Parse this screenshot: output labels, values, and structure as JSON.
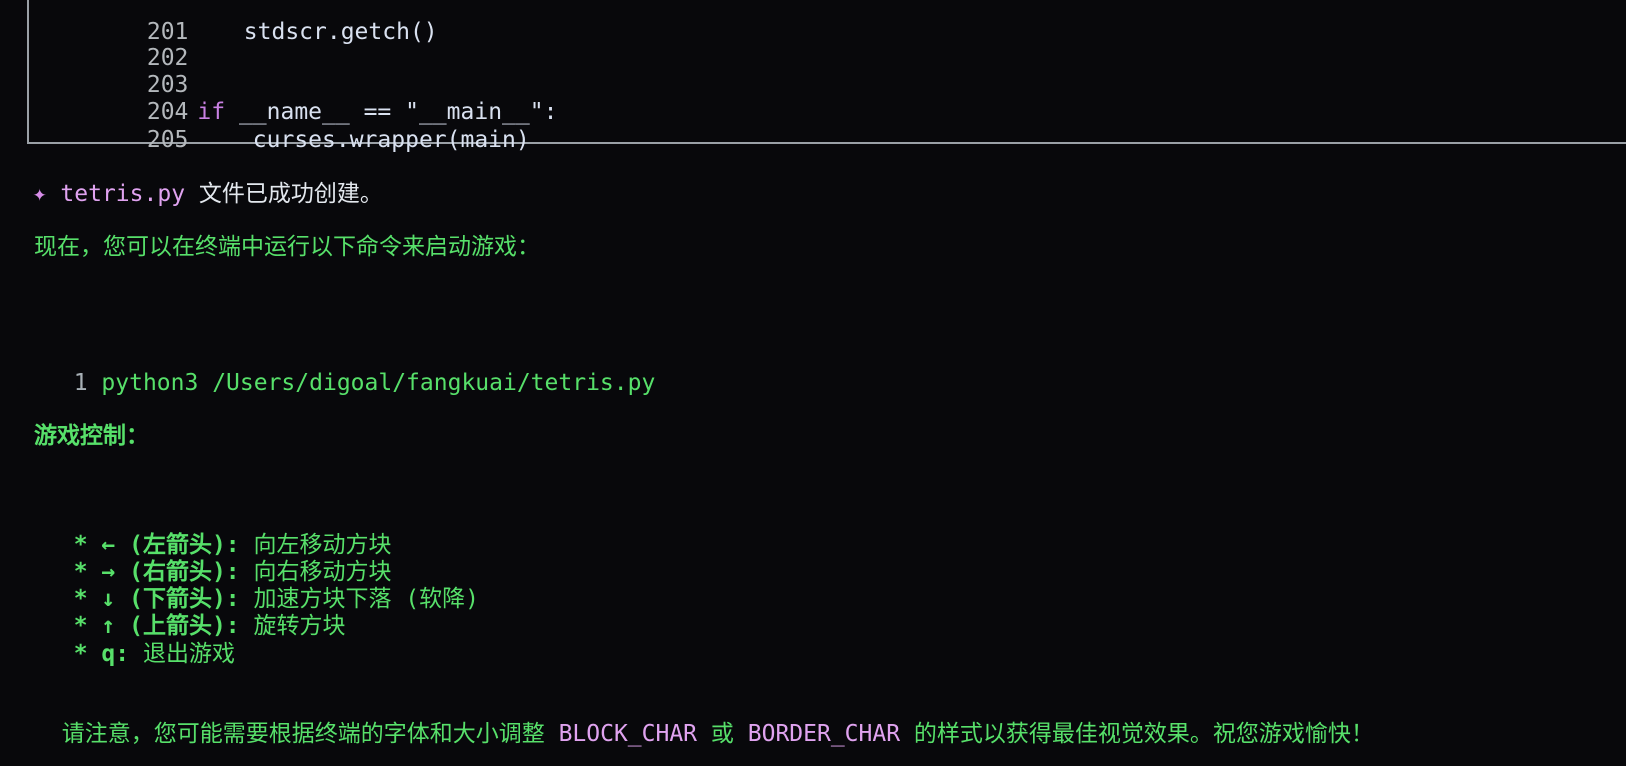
{
  "code_block": {
    "lines": [
      {
        "num": "201",
        "code": "    stdscr.getch()"
      },
      {
        "num": "202",
        "code": ""
      },
      {
        "num": "203",
        "code": ""
      },
      {
        "num": "204",
        "kw": "if",
        "code": " __name__ == \"__main__\":"
      },
      {
        "num": "205",
        "code": "    curses.wrapper(main)"
      }
    ]
  },
  "status": {
    "icon": "✦",
    "filename": "tetris.py",
    "message": " 文件已成功创建。"
  },
  "intro": "现在，您可以在终端中运行以下命令来启动游戏：",
  "command": {
    "num": "1",
    "text": "python3 /Users/digoal/fangkuai/tetris.py"
  },
  "controls": {
    "heading": "游戏控制：",
    "items": [
      {
        "key": "* ← (左箭头):",
        "desc": " 向左移动方块"
      },
      {
        "key": "* → (右箭头):",
        "desc": " 向右移动方块"
      },
      {
        "key": "* ↓ (下箭头):",
        "desc": " 加速方块下落 (软降)"
      },
      {
        "key": "* ↑ (上箭头):",
        "desc": " 旋转方块"
      },
      {
        "key": "* q:",
        "desc": " 退出游戏"
      }
    ]
  },
  "note": {
    "part1": "请注意，您可能需要根据终端的字体和大小调整 ",
    "block_char": "BLOCK_CHAR",
    "part2": " 或 ",
    "border_char": "BORDER_CHAR",
    "part3": " 的样式以获得最佳视觉效果。祝您游戏愉快！"
  }
}
